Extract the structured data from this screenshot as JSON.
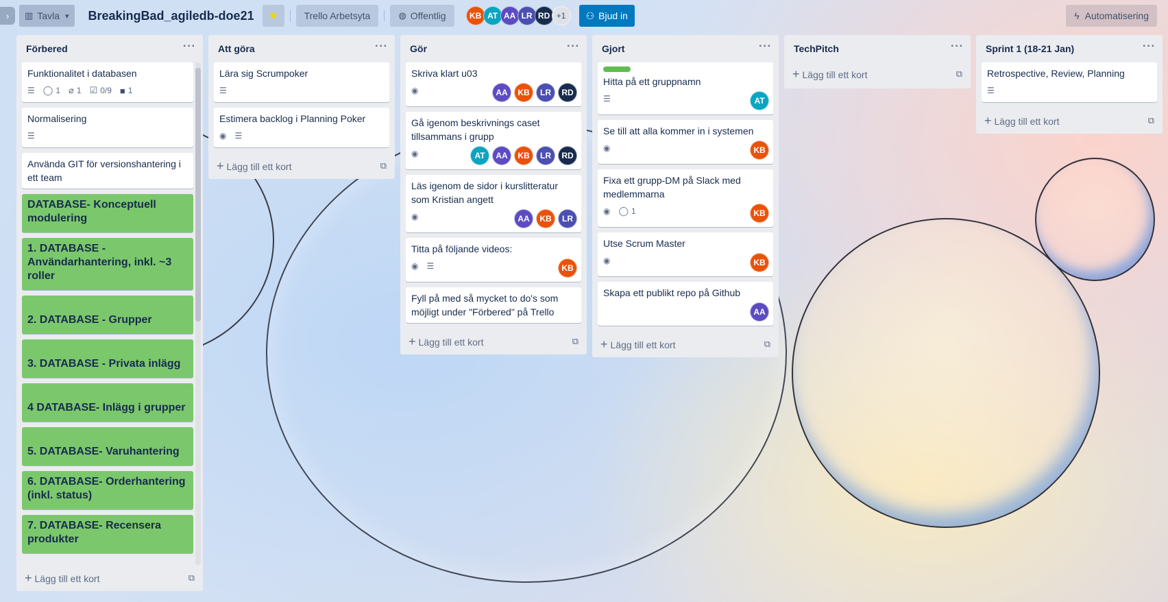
{
  "header": {
    "view_label": "Tavla",
    "board_title": "BreakingBad_agiledb-doe21",
    "workspace_label": "Trello Arbetsyta",
    "visibility_label": "Offentlig",
    "members": [
      {
        "initials": "KB",
        "color": "#e9520b"
      },
      {
        "initials": "AT",
        "color": "#0aa5c0"
      },
      {
        "initials": "AA",
        "color": "#5c4bc2"
      },
      {
        "initials": "LR",
        "color": "#4a4fb0"
      },
      {
        "initials": "RD",
        "color": "#172b4d"
      }
    ],
    "more_members": "+1",
    "invite_label": "Bjud in",
    "automation_label": "Automatisering"
  },
  "add_card_label": "Lägg till ett kort",
  "lists": [
    {
      "title": "Förbered",
      "cards": [
        {
          "title": "Funktionalitet i databasen",
          "comments": "1",
          "attachments": "1",
          "checklist": "0/9",
          "cover_count": "1"
        },
        {
          "title": "Normalisering"
        },
        {
          "title": "Använda GIT för versionshantering i ett team"
        },
        {
          "title": "DATABASE- Konceptuell modulering"
        },
        {
          "title": "1. DATABASE - Användarhantering, inkl. ~3 roller"
        },
        {
          "title": "2. DATABASE - Grupper"
        },
        {
          "title": "3. DATABASE - Privata inlägg"
        },
        {
          "title": "4 DATABASE- Inlägg i grupper"
        },
        {
          "title": "5. DATABASE- Varuhantering"
        },
        {
          "title": "6. DATABASE- Orderhantering (inkl. status)"
        },
        {
          "title": "7. DATABASE- Recensera produkter"
        }
      ]
    },
    {
      "title": "Att göra",
      "cards": [
        {
          "title": "Lära sig Scrumpoker"
        },
        {
          "title": "Estimera backlog i Planning Poker"
        }
      ]
    },
    {
      "title": "Gör",
      "cards": [
        {
          "title": "Skriva klart u03",
          "members": [
            "AA",
            "KB",
            "LR",
            "RD"
          ]
        },
        {
          "title": "Gå igenom beskrivnings caset tillsammans i grupp",
          "members": [
            "AT",
            "AA",
            "KB",
            "LR",
            "RD"
          ]
        },
        {
          "title": "Läs igenom de sidor i kurslitteratur som Kristian angett",
          "members": [
            "AA",
            "KB",
            "LR"
          ]
        },
        {
          "title": "Titta på följande videos:",
          "members": [
            "KB"
          ]
        },
        {
          "title": "Fyll på med så mycket to do's som möjligt under \"Förbered\" på Trello"
        }
      ]
    },
    {
      "title": "Gjort",
      "cards": [
        {
          "title": "Hitta på ett gruppnamn",
          "label_color": "#61bd4f",
          "members": [
            "AT"
          ]
        },
        {
          "title": "Se till att alla kommer in i systemen",
          "members": [
            "KB"
          ]
        },
        {
          "title": "Fixa ett grupp-DM på Slack med medlemmarna",
          "comments": "1",
          "members": [
            "KB"
          ]
        },
        {
          "title": "Utse Scrum Master",
          "members": [
            "KB"
          ]
        },
        {
          "title": "Skapa ett publikt repo på Github",
          "members": [
            "AA"
          ]
        }
      ]
    },
    {
      "title": "TechPitch",
      "cards": []
    },
    {
      "title": "Sprint 1 (18-21 Jan)",
      "cards": [
        {
          "title": "Retrospective, Review, Planning"
        }
      ]
    }
  ]
}
